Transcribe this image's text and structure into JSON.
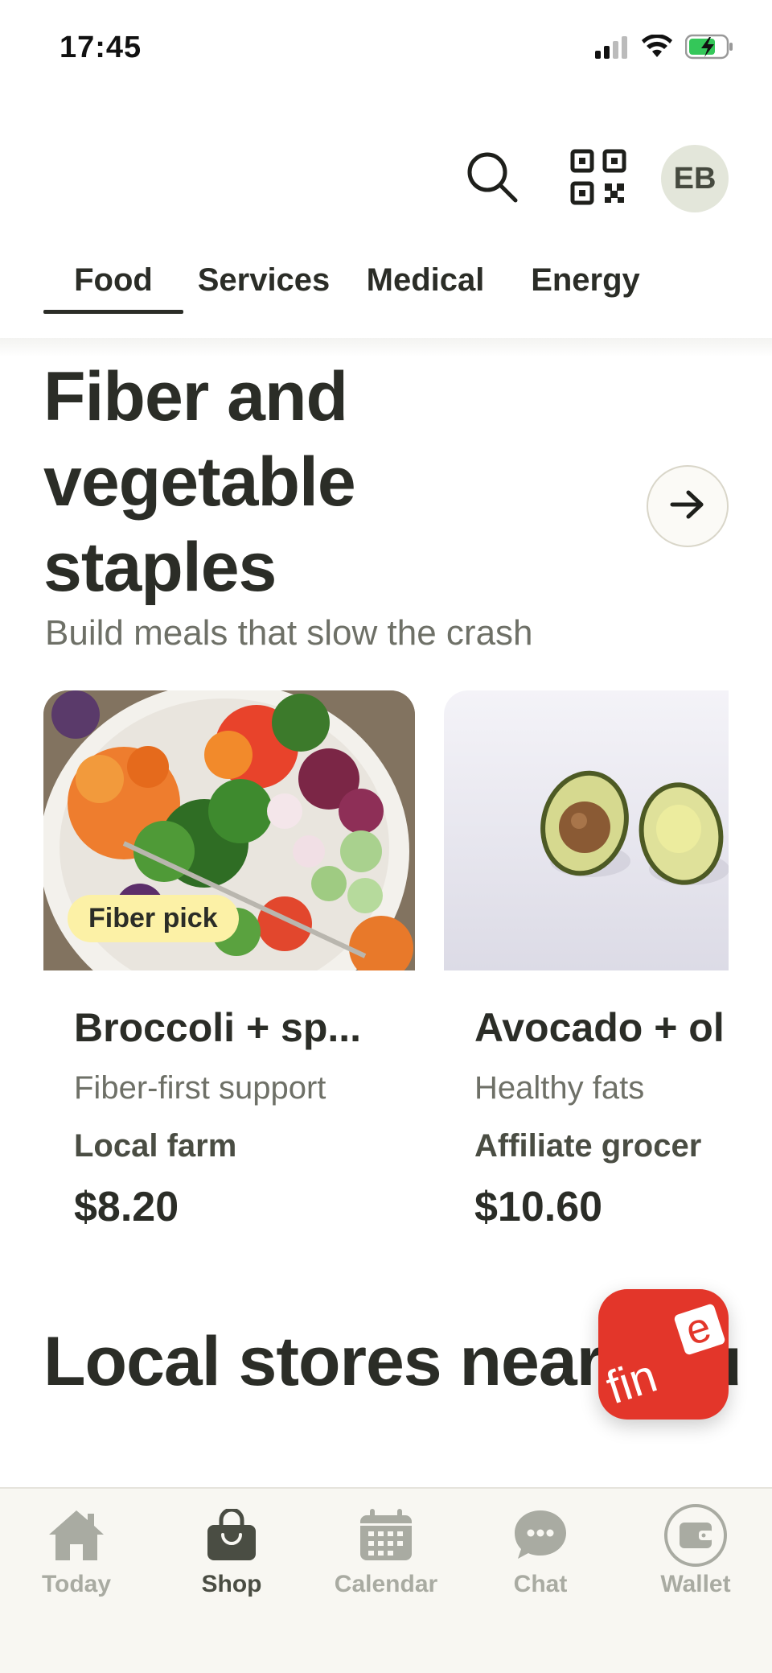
{
  "status_bar": {
    "time": "17:45"
  },
  "header": {
    "avatar_initials": "EB"
  },
  "tabs": [
    {
      "label": "Food",
      "active": true
    },
    {
      "label": "Services",
      "active": false
    },
    {
      "label": "Medical",
      "active": false
    },
    {
      "label": "Energy",
      "active": false
    }
  ],
  "section": {
    "title": "Fiber and vegetable staples",
    "subtitle": "Build meals that slow the crash"
  },
  "cards": [
    {
      "badge": "Fiber pick",
      "title": "Broccoli + sp...",
      "subtitle": "Fiber-first support",
      "vendor": "Local farm",
      "price": "$8.20"
    },
    {
      "badge": "",
      "title": "Avocado + ol",
      "subtitle": "Healthy fats",
      "vendor": "Affiliate grocer",
      "price": "$10.60"
    }
  ],
  "stores_section": {
    "title": "Local stores near you"
  },
  "fab": {
    "logo_text": "fine"
  },
  "bottom_nav": [
    {
      "label": "Today",
      "icon": "home-icon",
      "active": false
    },
    {
      "label": "Shop",
      "icon": "shopping-bag-icon",
      "active": true
    },
    {
      "label": "Calendar",
      "icon": "calendar-icon",
      "active": false
    },
    {
      "label": "Chat",
      "icon": "chat-icon",
      "active": false
    },
    {
      "label": "Wallet",
      "icon": "wallet-icon",
      "active": false
    }
  ],
  "colors": {
    "text": "#2b2d27",
    "muted": "#6e7067",
    "badge": "#fcf1a6",
    "fab": "#e3362a",
    "nav_inactive": "#a9aba2"
  }
}
